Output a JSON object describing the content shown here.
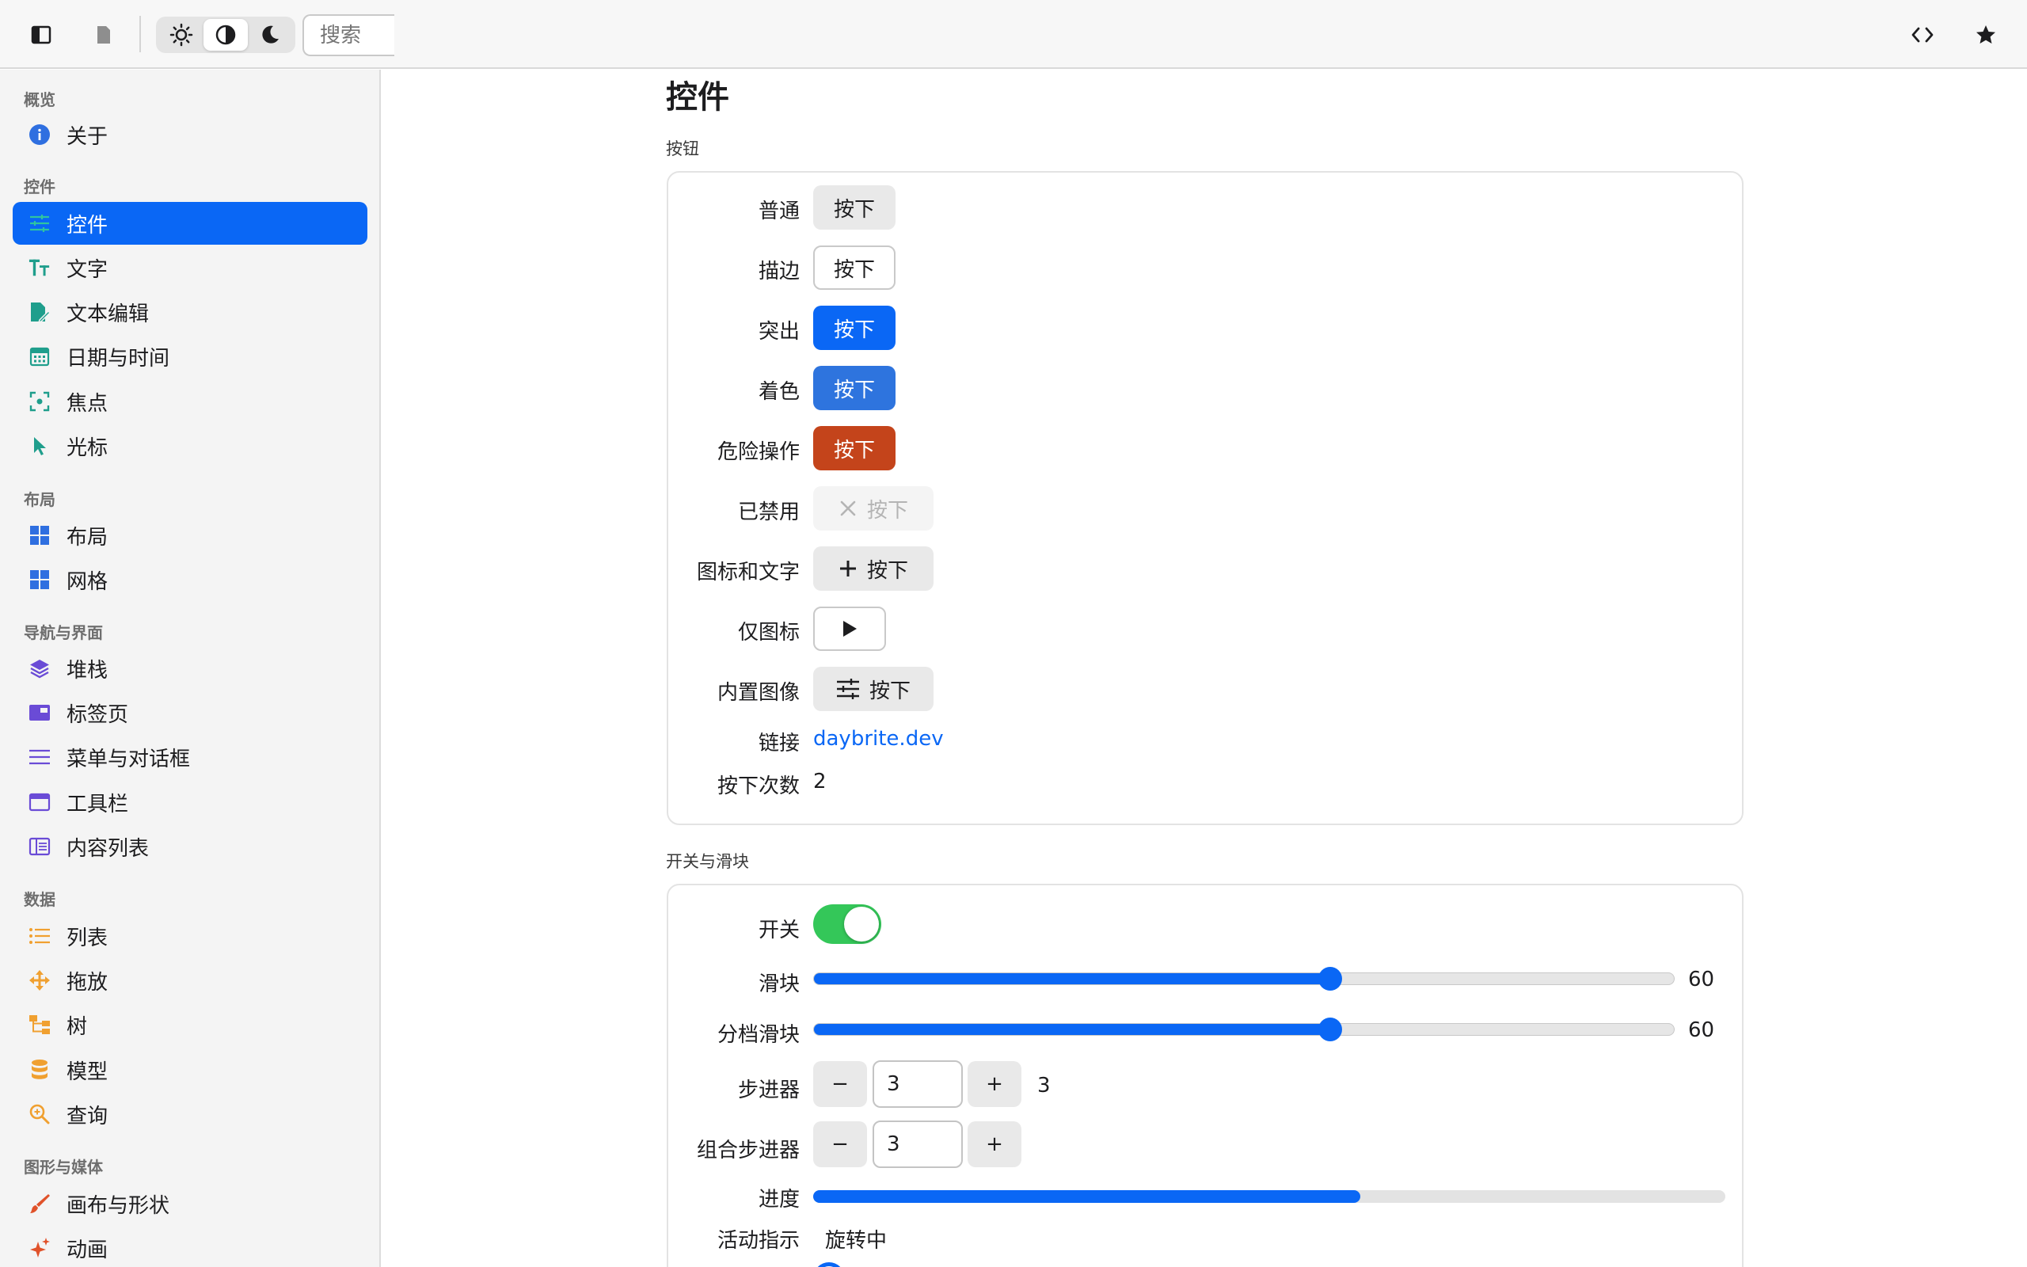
{
  "toolbar": {
    "search_placeholder": "搜索",
    "theme_options": [
      "light",
      "auto",
      "dark"
    ],
    "theme_selected": "auto"
  },
  "sidebar": {
    "sections": [
      {
        "label": "概览",
        "items": [
          {
            "label": "关于",
            "icon": "info-circle-icon"
          }
        ]
      },
      {
        "label": "控件",
        "items": [
          {
            "label": "控件",
            "icon": "sliders-icon",
            "active": true
          },
          {
            "label": "文字",
            "icon": "text-size-icon"
          },
          {
            "label": "文本编辑",
            "icon": "doc-edit-icon"
          },
          {
            "label": "日期与时间",
            "icon": "calendar-icon"
          },
          {
            "label": "焦点",
            "icon": "focus-icon"
          },
          {
            "label": "光标",
            "icon": "cursor-arrow-icon"
          }
        ]
      },
      {
        "label": "布局",
        "items": [
          {
            "label": "布局",
            "icon": "layout-grid-icon"
          },
          {
            "label": "网格",
            "icon": "grid-icon"
          }
        ]
      },
      {
        "label": "导航与界面",
        "items": [
          {
            "label": "堆栈",
            "icon": "stack-layers-icon"
          },
          {
            "label": "标签页",
            "icon": "tabs-icon"
          },
          {
            "label": "菜单与对话框",
            "icon": "menu-lines-icon"
          },
          {
            "label": "工具栏",
            "icon": "window-toolbar-icon"
          },
          {
            "label": "内容列表",
            "icon": "columns-icon"
          }
        ]
      },
      {
        "label": "数据",
        "items": [
          {
            "label": "列表",
            "icon": "list-icon"
          },
          {
            "label": "拖放",
            "icon": "move-arrows-icon"
          },
          {
            "label": "树",
            "icon": "tree-icon"
          },
          {
            "label": "模型",
            "icon": "database-icon"
          },
          {
            "label": "查询",
            "icon": "magnifier-icon"
          }
        ]
      },
      {
        "label": "图形与媒体",
        "items": [
          {
            "label": "画布与形状",
            "icon": "paintbrush-icon"
          },
          {
            "label": "动画",
            "icon": "sparkles-icon"
          }
        ]
      }
    ]
  },
  "main": {
    "title": "控件",
    "buttons_group": {
      "label": "按钮",
      "button_text": "按下",
      "rows": {
        "plain": "普通",
        "outline": "描边",
        "prominent": "突出",
        "tinted": "着色",
        "danger": "危险操作",
        "disabled": "已禁用",
        "icon_text": "图标和文字",
        "icon_only": "仅图标",
        "builtin_image": "内置图像",
        "link": "链接",
        "press_count": "按下次数"
      },
      "link_text": "daybrite.dev",
      "press_count_value": "2"
    },
    "switches_group": {
      "label": "开关与滑块",
      "switch_label": "开关",
      "switch_on": true,
      "slider_label": "滑块",
      "slider_value": "60",
      "slider_fraction": 0.6,
      "stepped_slider_label": "分档滑块",
      "stepped_slider_value": "60",
      "stepper_label": "步进器",
      "stepper_value": "3",
      "combo_stepper_label": "组合步进器",
      "combo_stepper_value": "3",
      "minus": "−",
      "plus": "+",
      "progress_label": "进度",
      "progress_fraction": 0.6,
      "activity_label": "活动指示",
      "activity_text": "旋转中"
    }
  },
  "colors": {
    "accent": "#0a67f5",
    "tinted": "#2e74de",
    "danger": "#c4441b",
    "switch_on": "#34c759"
  }
}
